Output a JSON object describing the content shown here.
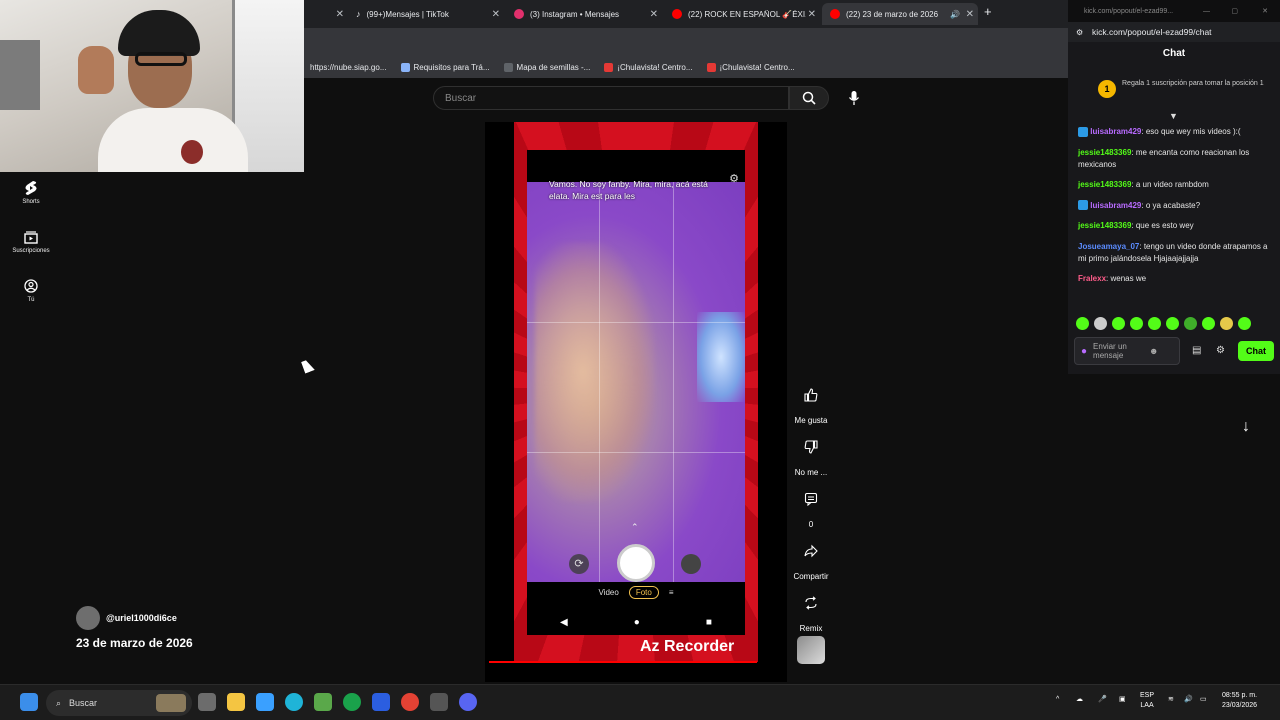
{
  "browser": {
    "tabs": [
      {
        "label": "",
        "color": "#5f6368"
      },
      {
        "label": "(99+)Mensajes | TikTok",
        "color": "#ffffff"
      },
      {
        "label": "(3) Instagram • Mensajes",
        "color": "#e1306c"
      },
      {
        "label": "(22) ROCK EN ESPAÑOL 🎸ÉXI...",
        "color": "#ff0000"
      },
      {
        "label": "(22) 23 de marzo de 2026",
        "color": "#ff0000"
      }
    ],
    "bookmarks": [
      {
        "label": "https://nube.siap.go...",
        "color": "#5f6368"
      },
      {
        "label": "Requisitos para Trá...",
        "color": "#8ab4f8"
      },
      {
        "label": "Mapa de semillas -...",
        "color": "#5f6368"
      },
      {
        "label": "¡Chulavista! Centro...",
        "color": "#e53935"
      },
      {
        "label": "¡Chulavista! Centro...",
        "color": "#e53935"
      }
    ]
  },
  "youtube": {
    "search_placeholder": "Buscar",
    "nav": [
      {
        "label": "Shorts",
        "icon": "shorts-icon"
      },
      {
        "label": "Suscripciones",
        "icon": "subscriptions-icon"
      },
      {
        "label": "Tú",
        "icon": "you-icon"
      }
    ],
    "video": {
      "caption": "Vamos. No soy fanby. Mira, mira, acá está elata. Mira est para les",
      "modes": [
        "Video",
        "Foto"
      ],
      "selected_mode": "Foto",
      "watermark": "Az Recorder"
    },
    "actions": {
      "like": "Me gusta",
      "dislike": "No me ...",
      "comments": "0",
      "share": "Compartir",
      "remix": "Remix"
    },
    "channel": "@uriel1000di6ce",
    "title": "23 de marzo de 2026"
  },
  "kick": {
    "url_small": "kick.com/popout/el-ezad99...",
    "url": "kick.com/popout/el-ezad99/chat",
    "title": "Chat",
    "promo_rank": "1",
    "promo_text": "Regala 1 suscripción para tomar la posición 1",
    "messages": [
      {
        "user": "luisabram429",
        "text": ": eso que wey mis videos ):(",
        "color": "#b86bff"
      },
      {
        "user": "jessie1483369",
        "text": ": me encanta como reacionan los mexicanos",
        "color": "#53fc18"
      },
      {
        "user": "jessie1483369",
        "text": ": a un video rambdom",
        "color": "#53fc18"
      },
      {
        "user": "luisabram429",
        "text": ": o ya acabaste?",
        "color": "#b86bff"
      },
      {
        "user": "jessie1483369",
        "text": ": que es esto wey",
        "color": "#53fc18"
      },
      {
        "user": "Josueamaya_07",
        "text": ": tengo un video donde atrapamos a mi primo jalándosela Hjajaajajjajja",
        "color": "#5b8cff"
      },
      {
        "user": "Fralexx",
        "text": ": wenas we",
        "color": "#ff5c8a"
      }
    ],
    "input_placeholder": "Enviar un mensaje",
    "send_label": "Chat"
  },
  "taskbar": {
    "search_label": "Buscar",
    "lang": "ESP",
    "lang_sub": "LAA",
    "time": "08:55 p. m.",
    "date": "23/03/2026"
  }
}
